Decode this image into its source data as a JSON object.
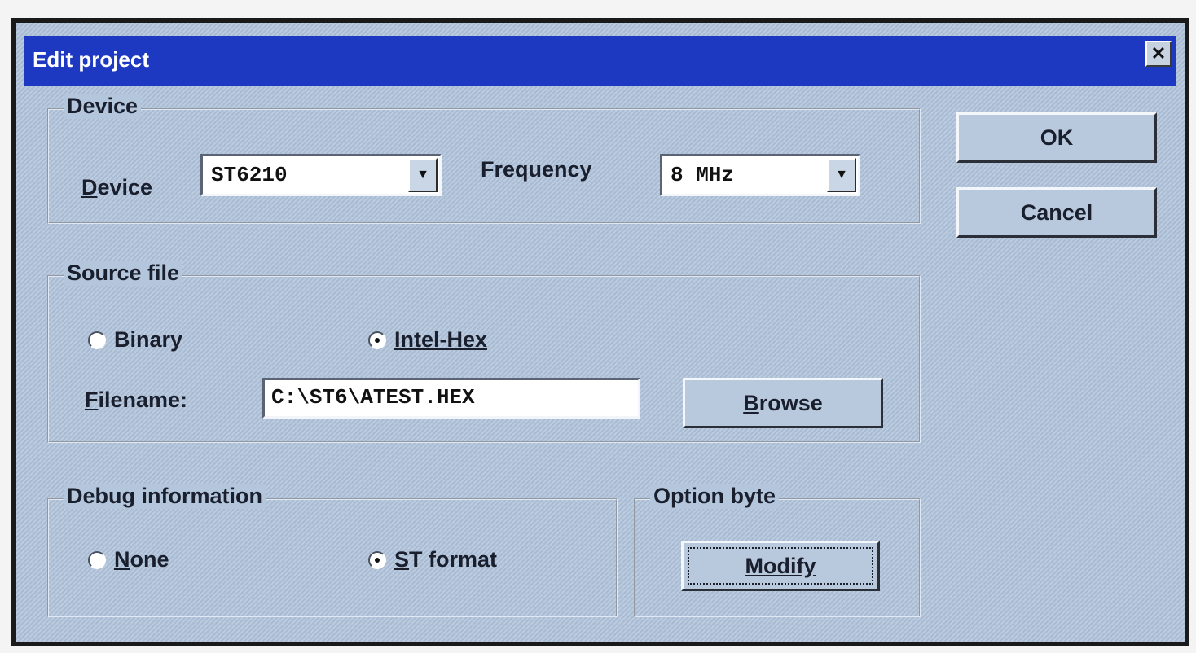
{
  "window": {
    "title": "Edit project",
    "close_glyph": "✕"
  },
  "device_group": {
    "legend": "Device",
    "device_label_underline": "D",
    "device_label_rest": "evice",
    "device_value": "ST6210",
    "frequency_label": "Frequency",
    "frequency_value": "8 MHz"
  },
  "source_group": {
    "legend": "Source file",
    "binary_label": "Binary",
    "intelhex_label": "Intel-Hex",
    "selected": "Intel-Hex",
    "filename_label_underline": "F",
    "filename_label_rest": "ilename:",
    "filename_value": "C:\\ST6\\ATEST.HEX",
    "browse_underline": "B",
    "browse_rest": "rowse"
  },
  "debug_group": {
    "legend": "Debug information",
    "none_underline": "N",
    "none_rest": "one",
    "st_underline": "S",
    "st_rest": "T format",
    "selected": "ST format"
  },
  "option_group": {
    "legend": "Option byte",
    "modify_label": "Modify"
  },
  "buttons": {
    "ok": "OK",
    "cancel": "Cancel"
  },
  "icons": {
    "dropdown": "▼"
  }
}
